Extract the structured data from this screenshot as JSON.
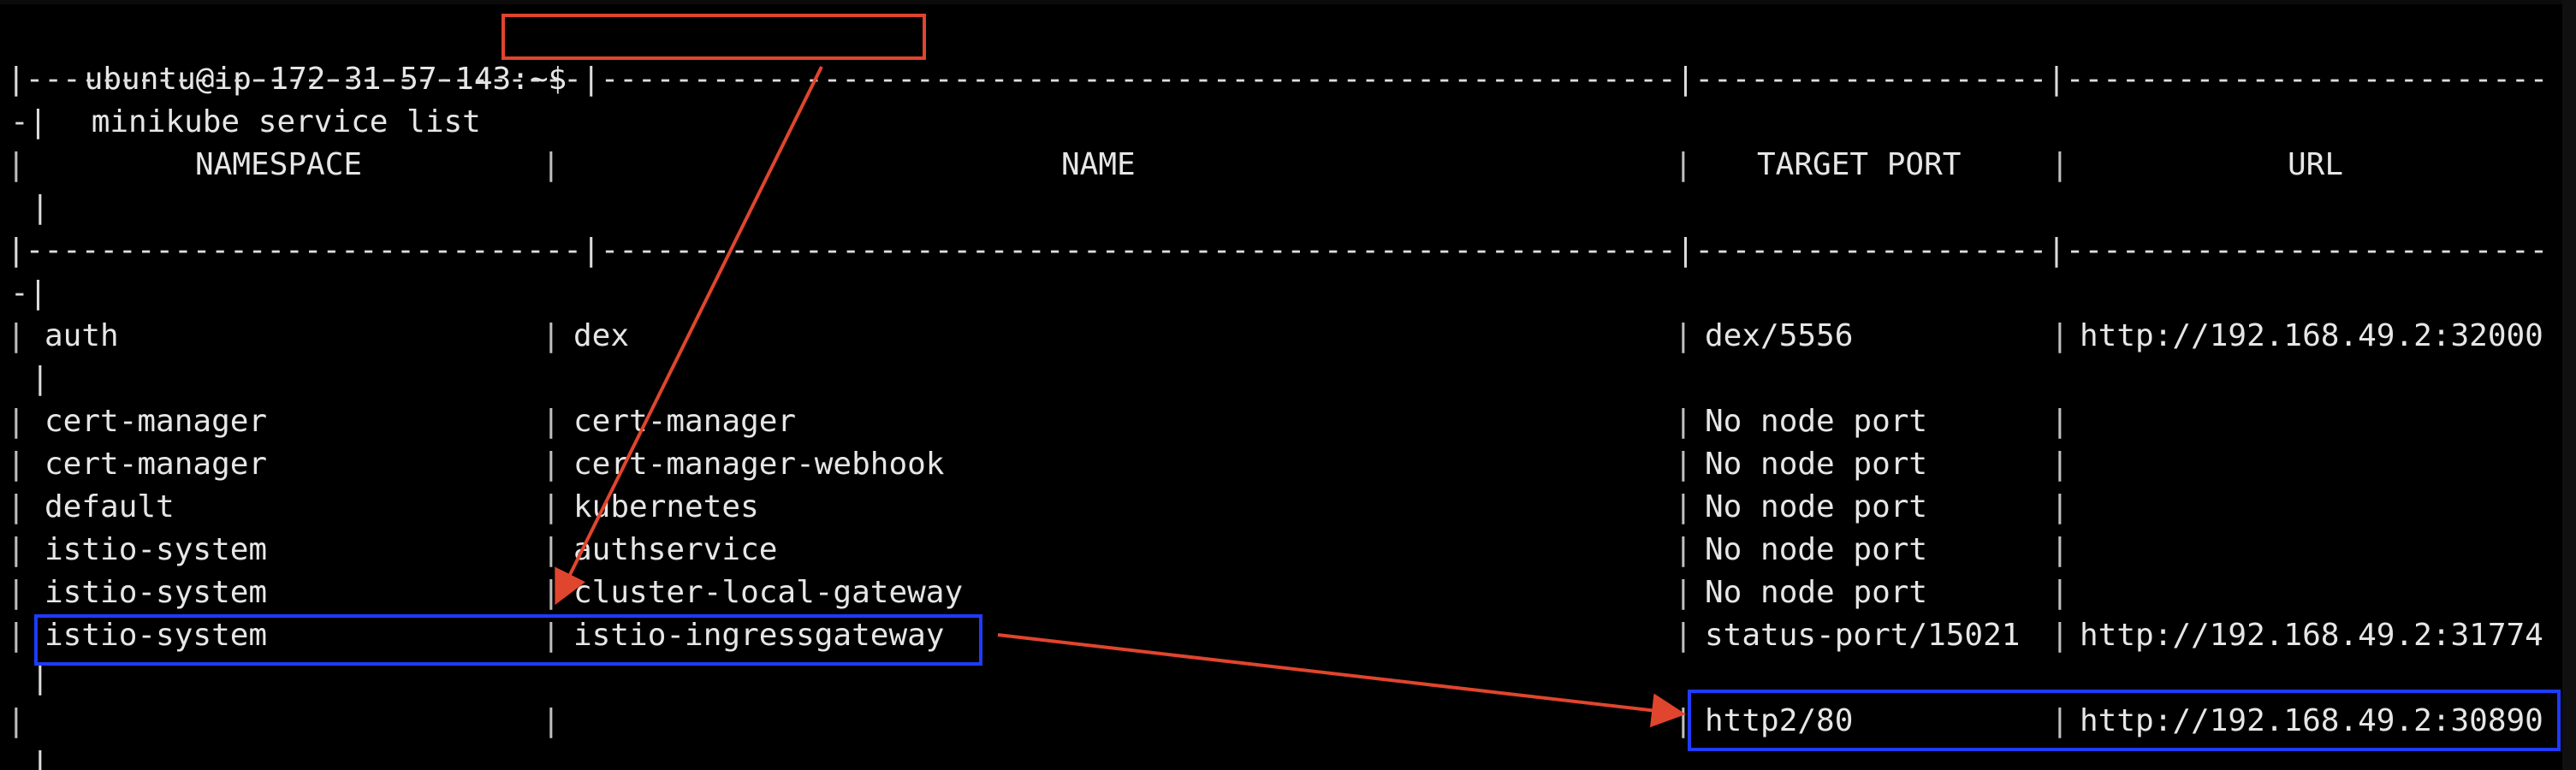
{
  "terminal": {
    "prompt": "ubuntu@ip-172-31-57-143:~$",
    "command": "minikube service list",
    "border_line": "|------------------------------|----------------------------------------------------------|-------------------|--------------------------",
    "wrap_char": "-|",
    "wrap_pipe": "|",
    "headers": {
      "namespace": "NAMESPACE",
      "name": "NAME",
      "target_port": "TARGET PORT",
      "url": "URL"
    },
    "rows": [
      {
        "namespace": "auth",
        "name": "dex",
        "target_port": "dex/5556",
        "url": "http://192.168.49.2:32000"
      },
      {
        "namespace": "cert-manager",
        "name": "cert-manager",
        "target_port": "No node port",
        "url": ""
      },
      {
        "namespace": "cert-manager",
        "name": "cert-manager-webhook",
        "target_port": "No node port",
        "url": ""
      },
      {
        "namespace": "default",
        "name": "kubernetes",
        "target_port": "No node port",
        "url": ""
      },
      {
        "namespace": "istio-system",
        "name": "authservice",
        "target_port": "No node port",
        "url": ""
      },
      {
        "namespace": "istio-system",
        "name": "cluster-local-gateway",
        "target_port": "No node port",
        "url": ""
      },
      {
        "namespace": "istio-system",
        "name": "istio-ingressgateway",
        "target_port": "status-port/15021",
        "url": "http://192.168.49.2:31774"
      },
      {
        "namespace": "",
        "name": "",
        "target_port": "http2/80",
        "url": "http://192.168.49.2:30890"
      }
    ]
  },
  "annotations": {
    "highlight_color_red": "#e0452d",
    "highlight_color_blue": "#1f3bff"
  }
}
